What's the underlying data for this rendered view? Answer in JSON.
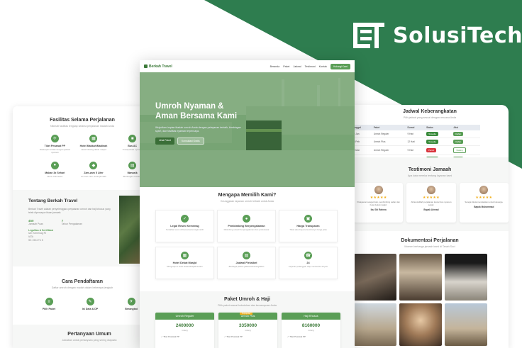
{
  "colors": {
    "brand_green": "#2e7d4f",
    "accent_green": "#5a9e56",
    "star": "#f2b01e",
    "full_red": "#d9363e"
  },
  "brand": {
    "name": "SolusiTech."
  },
  "main": {
    "nav": {
      "logo": "Berkah Travel",
      "links": [
        "Beranda",
        "Paket",
        "Jadwal",
        "Testimoni",
        "Kontak"
      ],
      "cta": "Hubungi Kami"
    },
    "hero": {
      "title": "Umroh Nyaman & Aman Bersama Kami",
      "subtitle": "Wujudkan impian ibadah umroh Anda dengan pelayanan terbaik, bimbingan syar'i, dan fasilitas nyaman terpercaya.",
      "btn_primary": "Lihat Paket",
      "btn_secondary": "Konsultasi Gratis"
    },
    "why": {
      "title": "Mengapa Memilih Kami?",
      "subtitle": "Keunggulan layanan umroh terbaik untuk Anda",
      "items": [
        {
          "icon": "shield-icon",
          "label": "Legal Resmi Kemenag",
          "desc": "Terdaftar resmi di Kementerian Agama RI"
        },
        {
          "icon": "user-icon",
          "label": "Pembimbing Berpengalaman",
          "desc": "Dibimbing ustadz berpengalaman dan profesional"
        },
        {
          "icon": "ticket-icon",
          "label": "Harga Transparan",
          "desc": "Tidak ada biaya tersembunyi, harga jelas"
        },
        {
          "icon": "hotel-icon",
          "label": "Hotel Dekat Masjid",
          "desc": "Menginap di hotel dekat Masjidil Haram"
        },
        {
          "icon": "calendar-icon",
          "label": "Jadwal Fleksibel",
          "desc": "Berbagai pilihan jadwal keberangkatan"
        },
        {
          "icon": "phone-icon",
          "label": "24",
          "desc": "Layanan pelanggan siap membantu 24 jam"
        }
      ]
    },
    "packages": {
      "title": "Paket Umroh & Haji",
      "subtitle": "Pilih paket sesuai kebutuhan dan kemampuan Anda",
      "items": [
        {
          "name": "Umroh Reguler",
          "price": "2400000",
          "unit": "/orang",
          "feature": "Tiket Pesawat PP",
          "badge": ""
        },
        {
          "name": "Umroh Plus",
          "price": "3350000",
          "unit": "/orang",
          "feature": "Tiket Pesawat PP",
          "badge": "Terpopuler"
        },
        {
          "name": "Haji Khusus",
          "price": "8160000",
          "unit": "/orang",
          "feature": "Tiket Pesawat PP",
          "badge": ""
        }
      ]
    }
  },
  "left": {
    "facilities": {
      "title": "Fasilitas Selama Perjalanan",
      "subtitle": "Nikmati fasilitas lengkap selama perjalanan ibadah Anda",
      "items": [
        {
          "icon": "plane-icon",
          "label": "Tiket Pesawat PP",
          "desc": "Maskapai terbaik dengan jadwal nyaman"
        },
        {
          "icon": "hotel-icon",
          "label": "Hotel Makkah/Madinah",
          "desc": "Hotel bintang dekat masjid"
        },
        {
          "icon": "bus-icon",
          "label": "Bus AC",
          "desc": "Transportasi nyaman"
        },
        {
          "icon": "food-icon",
          "label": "Makan 3x Sehari",
          "desc": "Menu Indonesia"
        },
        {
          "icon": "water-icon",
          "label": "Zam-zam 5 Liter",
          "desc": "Air zam-zam untuk jamaah"
        },
        {
          "icon": "book-icon",
          "label": "Manasik",
          "desc": "Bimbingan manasik"
        }
      ]
    },
    "about": {
      "title": "Tentang Berkah Travel",
      "text": "Berkah Travel adalah penyelenggara perjalanan umroh dan haji khusus yang telah dipercaya ribuan jamaah.",
      "stats": [
        {
          "num": "450",
          "label": "Jamaah Puas"
        },
        {
          "num": "7",
          "label": "Tahun Pengalaman"
        }
      ],
      "license_title": "Legalitas & Sertifikasi",
      "license_items": [
        "Izin Kemenag RI",
        "IATA",
        "SK 1924 Th 5"
      ]
    },
    "steps": {
      "title": "Cara Pendaftaran",
      "subtitle": "Daftar umroh dengan mudah dalam beberapa langkah",
      "items": [
        {
          "label": "Pilih Paket",
          "icon": "list-icon"
        },
        {
          "label": "Isi Data & DP",
          "icon": "form-icon"
        },
        {
          "label": "Berangkat",
          "icon": "plane-icon"
        }
      ]
    },
    "faq": {
      "title": "Pertanyaan Umum",
      "subtitle": "Jawaban untuk pertanyaan yang sering diajukan"
    }
  },
  "right": {
    "schedule": {
      "title": "Jadwal Keberangkatan",
      "subtitle": "Pilih jadwal yang sesuai dengan rencana Anda",
      "headers": [
        "Tanggal",
        "Paket",
        "Durasi",
        "Status",
        "Aksi"
      ],
      "rows": [
        {
          "date": "12 Jan",
          "paket": "Umroh Reguler",
          "durasi": "9 Hari",
          "status": "Tersedia",
          "full": false,
          "aksi": "Daftar"
        },
        {
          "date": "25 Feb",
          "paket": "Umroh Plus",
          "durasi": "12 Hari",
          "status": "Tersedia",
          "full": false,
          "aksi": "Daftar"
        },
        {
          "date": "10 Mar",
          "paket": "Umroh Reguler",
          "durasi": "9 Hari",
          "status": "Penuh",
          "full": true,
          "aksi": "Waiting"
        },
        {
          "date": "18 Apr",
          "paket": "Haji Khusus",
          "durasi": "25 Hari",
          "status": "Tersedia",
          "full": false,
          "aksi": "Daftar"
        }
      ]
    },
    "testimonials": {
      "title": "Testimoni Jamaah",
      "subtitle": "Apa kata mereka tentang layanan kami",
      "items": [
        {
          "stars": "★★★★★",
          "quote": "Pelayanan sangat baik, pembimbing sabar dan hotel dekat masjid.",
          "name": "Ibu Siti Rahma"
        },
        {
          "stars": "★★★★★",
          "quote": "Alhamdulillah perjalanan lancar dan nyaman sekali.",
          "name": "Bapak Ahmad"
        },
        {
          "stars": "★★★★★",
          "quote": "Sangat direkomendasikan untuk keluarga.",
          "name": "Bapak Muhammad"
        }
      ]
    },
    "docs": {
      "title": "Dokumentasi Perjalanan",
      "subtitle": "Momen berharga jamaah kami di Tanah Suci"
    }
  }
}
